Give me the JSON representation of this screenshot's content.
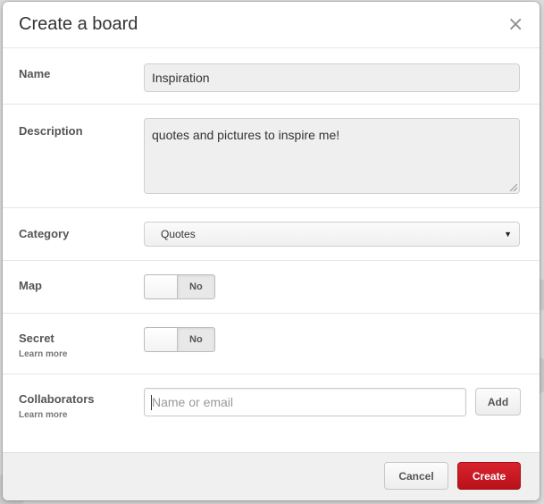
{
  "dialog": {
    "title": "Create a board",
    "close_glyph": "×"
  },
  "form": {
    "name": {
      "label": "Name",
      "value": "Inspiration"
    },
    "description": {
      "label": "Description",
      "value": "quotes and pictures to inspire me!"
    },
    "category": {
      "label": "Category",
      "selected": "Quotes"
    },
    "map": {
      "label": "Map",
      "state": "No"
    },
    "secret": {
      "label": "Secret",
      "learn_more": "Learn more",
      "state": "No"
    },
    "collaborators": {
      "label": "Collaborators",
      "learn_more": "Learn more",
      "placeholder": "Name or email",
      "add_label": "Add"
    }
  },
  "footer": {
    "cancel_label": "Cancel",
    "create_label": "Create"
  },
  "colors": {
    "primary": "#cb1c24",
    "border": "#e6e6e6",
    "footer_bg": "#f0f0f0"
  },
  "icons": {
    "close": "close-icon",
    "dropdown": "caret-down-icon"
  }
}
